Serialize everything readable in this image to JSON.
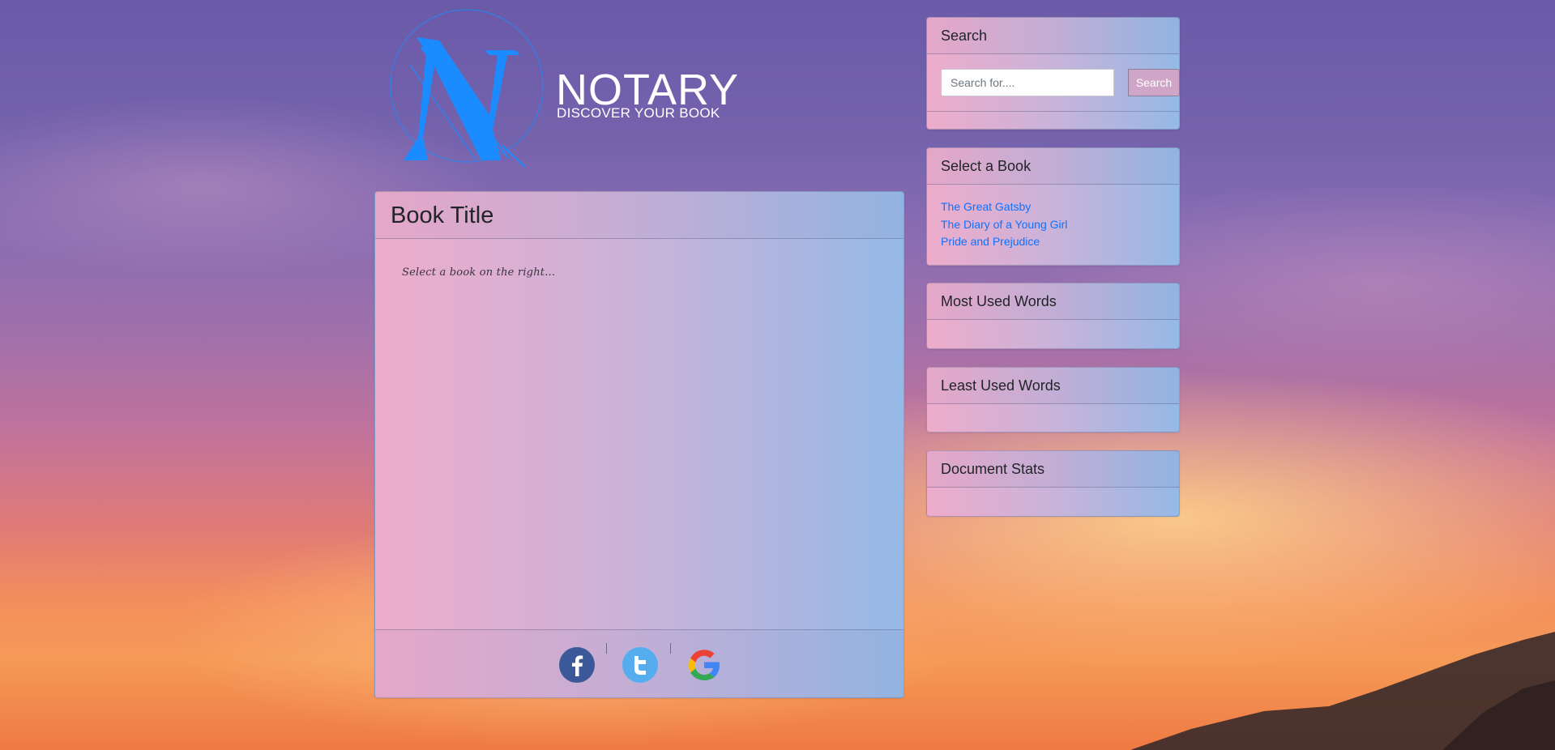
{
  "brand": {
    "name": "NOTARY",
    "tagline": "DISCOVER YOUR BOOK",
    "logo_letter": "N"
  },
  "main": {
    "title": "Book Title",
    "placeholder": "Select a book on the right..."
  },
  "social": [
    {
      "icon": "facebook-icon",
      "color": "#3b5998"
    },
    {
      "icon": "twitter-icon",
      "color": "#55acee"
    },
    {
      "icon": "google-icon",
      "color": "#4285f4"
    }
  ],
  "sidebar": {
    "search": {
      "title": "Search",
      "placeholder": "Search for....",
      "button_label": "Search"
    },
    "select_book": {
      "title": "Select a Book",
      "books": [
        "The Great Gatsby",
        "The Diary of a Young Girl",
        "Pride and Prejudice"
      ]
    },
    "most_used": {
      "title": "Most Used Words"
    },
    "least_used": {
      "title": "Least Used Words"
    },
    "stats": {
      "title": "Document Stats"
    }
  },
  "colors": {
    "card_gradient_start": "#eeaccb",
    "card_gradient_end": "#95b9e6",
    "link": "#0d72ff",
    "logo_blue": "#1a8cff"
  }
}
